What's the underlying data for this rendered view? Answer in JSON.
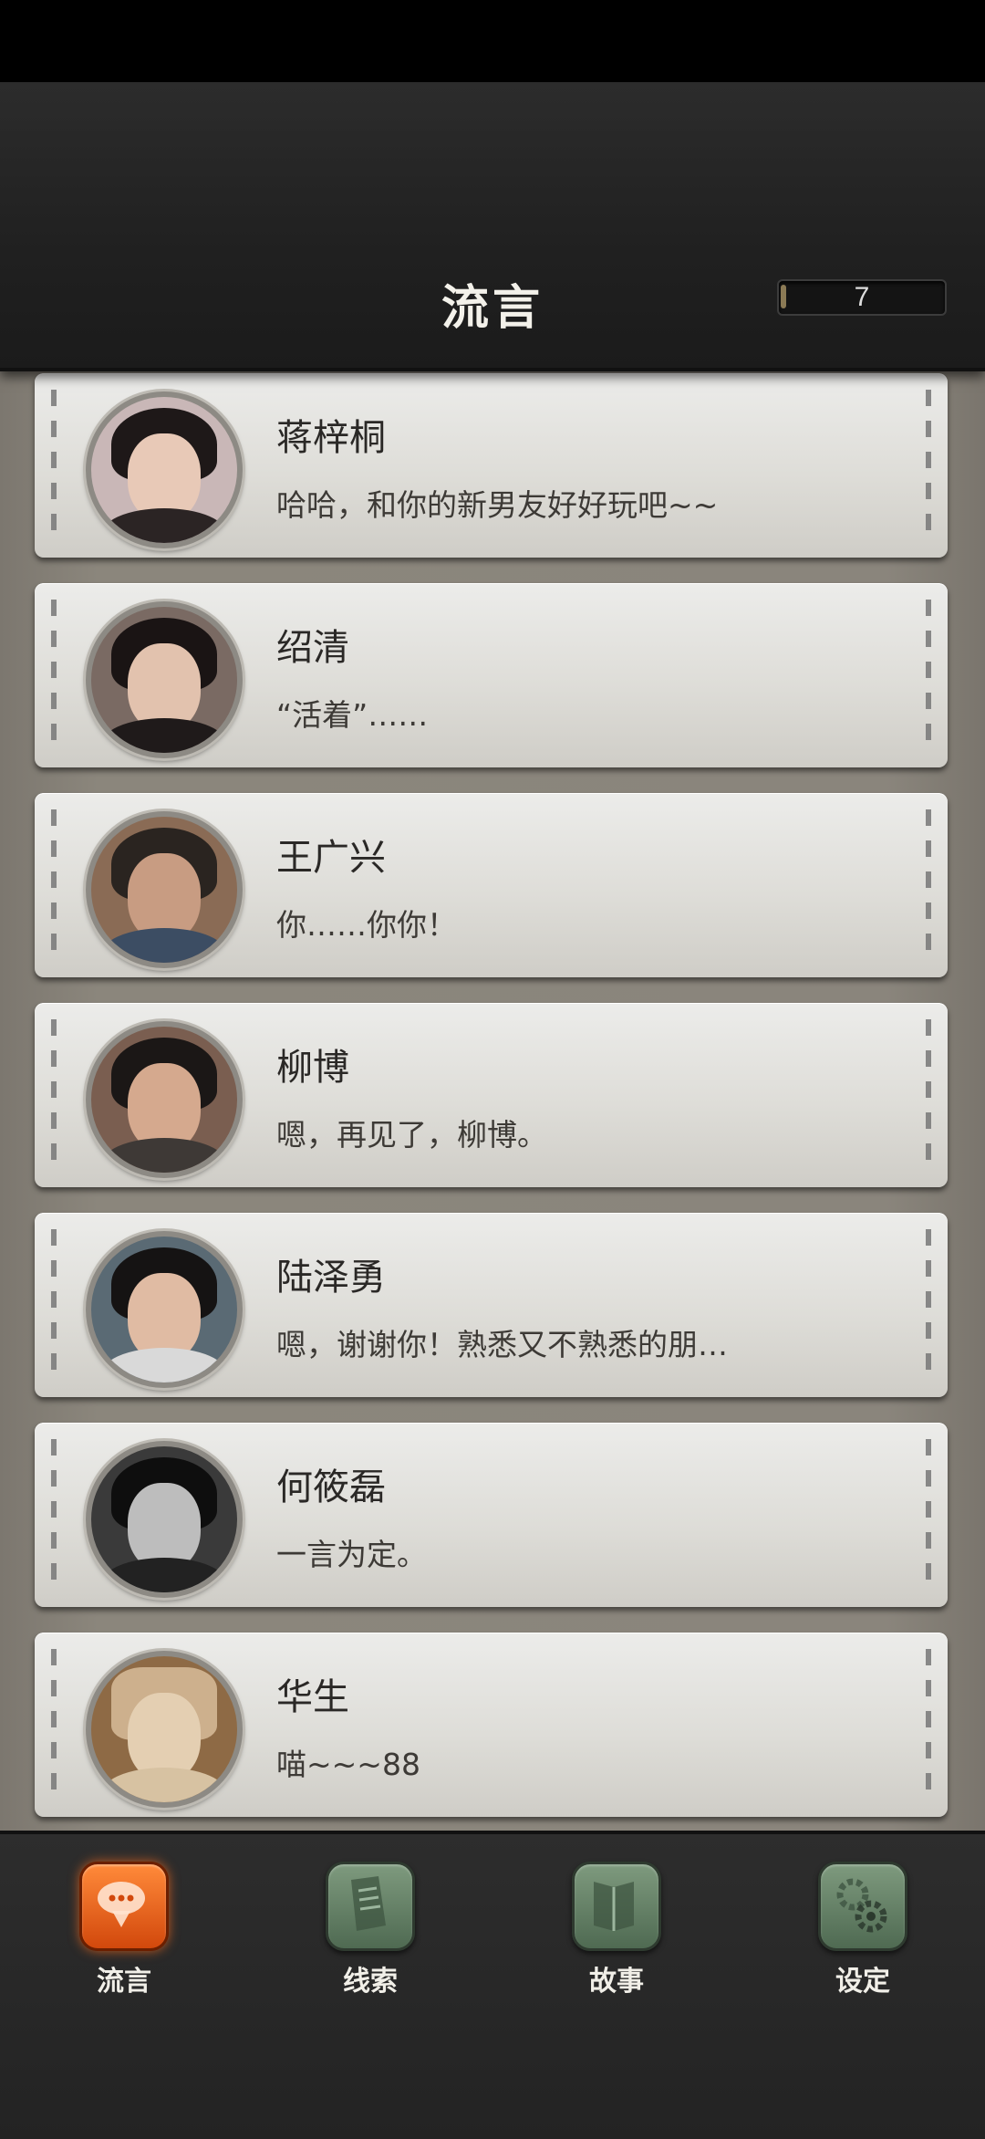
{
  "header": {
    "title": "流言",
    "counter": "7"
  },
  "contacts": [
    {
      "name": "蒋梓桐",
      "message": "哈哈，和你的新男友好好玩吧~~"
    },
    {
      "name": "绍清",
      "message": "“活着”……"
    },
    {
      "name": "王广兴",
      "message": "你……你你！"
    },
    {
      "name": "柳博",
      "message": "嗯，再见了，柳博。"
    },
    {
      "name": "陆泽勇",
      "message": "嗯，谢谢你！熟悉又不熟悉的朋…"
    },
    {
      "name": "何筱磊",
      "message": "一言为定。"
    },
    {
      "name": "华生",
      "message": "喵~~~88"
    }
  ],
  "tabs": [
    {
      "label": "流言",
      "icon": "chat-bubble-icon",
      "active": true
    },
    {
      "label": "线索",
      "icon": "document-icon",
      "active": false
    },
    {
      "label": "故事",
      "icon": "book-icon",
      "active": false
    },
    {
      "label": "设定",
      "icon": "gear-icon",
      "active": false
    }
  ],
  "colors": {
    "accent": "#e8621c",
    "tab_green": "#5f7c62"
  }
}
